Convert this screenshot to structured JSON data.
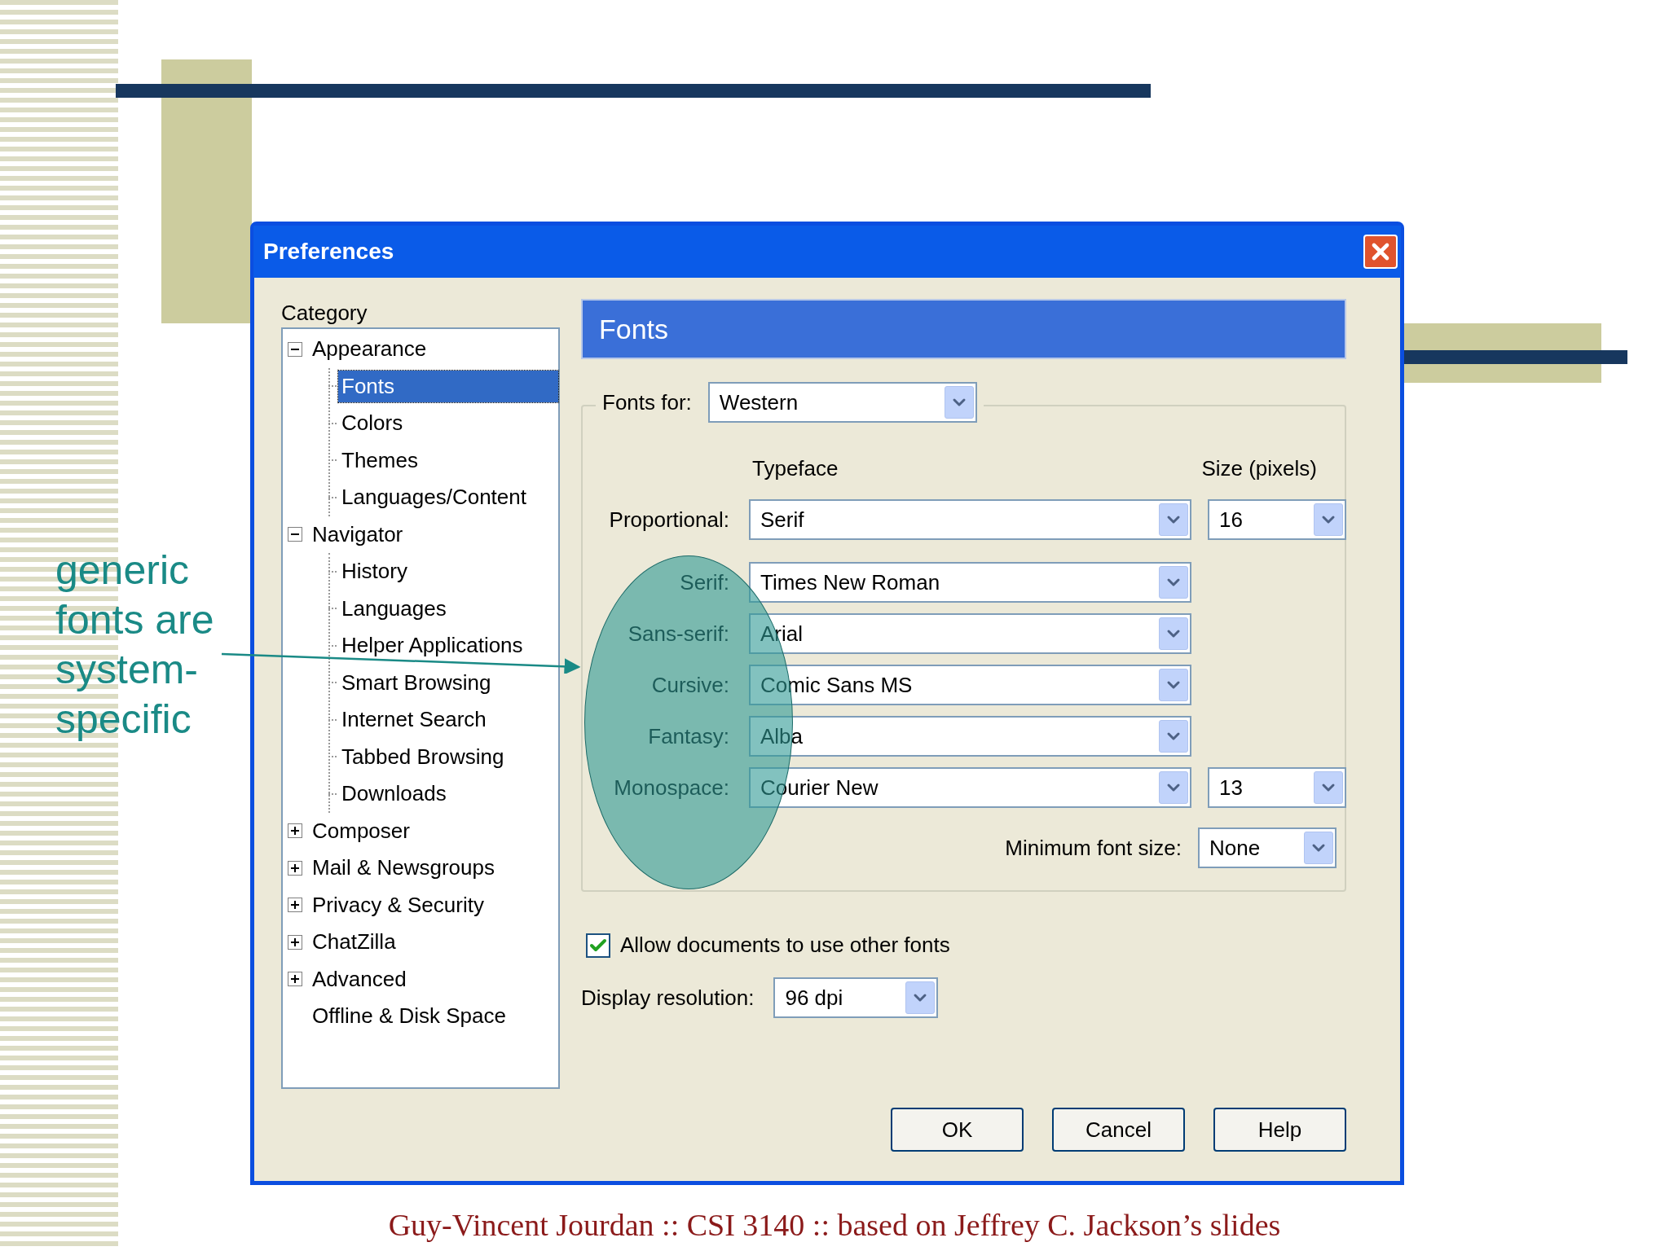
{
  "slide": {
    "side_note": "generic fonts are system-specific",
    "footer": "Guy-Vincent Jourdan :: CSI 3140 :: based on Jeffrey C. Jackson’s slides"
  },
  "dialog": {
    "title": "Preferences",
    "category_label": "Category",
    "tree": [
      {
        "label": "Appearance",
        "expanded": true,
        "selected": false,
        "children": [
          {
            "label": "Fonts",
            "selected": true
          },
          {
            "label": "Colors",
            "selected": false
          },
          {
            "label": "Themes",
            "selected": false
          },
          {
            "label": "Languages/Content",
            "selected": false
          }
        ]
      },
      {
        "label": "Navigator",
        "expanded": true,
        "selected": false,
        "children": [
          {
            "label": "History",
            "selected": false
          },
          {
            "label": "Languages",
            "selected": false
          },
          {
            "label": "Helper Applications",
            "selected": false
          },
          {
            "label": "Smart Browsing",
            "selected": false
          },
          {
            "label": "Internet Search",
            "selected": false
          },
          {
            "label": "Tabbed Browsing",
            "selected": false
          },
          {
            "label": "Downloads",
            "selected": false
          }
        ]
      },
      {
        "label": "Composer",
        "expanded": false,
        "selected": false
      },
      {
        "label": "Mail & Newsgroups",
        "expanded": false,
        "selected": false
      },
      {
        "label": "Privacy & Security",
        "expanded": false,
        "selected": false
      },
      {
        "label": "ChatZilla",
        "expanded": false,
        "selected": false
      },
      {
        "label": "Advanced",
        "expanded": false,
        "selected": false
      },
      {
        "label": "Offline & Disk Space",
        "selected": false
      }
    ],
    "panel_title": "Fonts",
    "fonts_for": {
      "label": "Fonts for:",
      "value": "Western"
    },
    "column_headers": [
      "Typeface",
      "Size (pixels)"
    ],
    "rows": [
      {
        "label": "Proportional:",
        "typeface": "Serif",
        "size": "16"
      },
      {
        "label": "Serif:",
        "typeface": "Times New Roman"
      },
      {
        "label": "Sans-serif:",
        "typeface": "Arial"
      },
      {
        "label": "Cursive:",
        "typeface": "Comic Sans MS"
      },
      {
        "label": "Fantasy:",
        "typeface": "Alba"
      },
      {
        "label": "Monospace:",
        "typeface": "Courier New",
        "size": "13"
      }
    ],
    "minimum_font_size": {
      "label": "Minimum font size:",
      "value": "None"
    },
    "allow_documents": {
      "label": "Allow documents to use other fonts",
      "checked": true
    },
    "display_resolution": {
      "label": "Display resolution:",
      "value": "96 dpi"
    },
    "buttons": [
      "OK",
      "Cancel",
      "Help"
    ]
  }
}
